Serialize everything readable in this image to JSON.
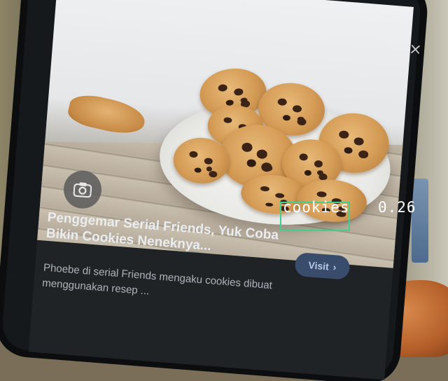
{
  "scene": {
    "background_icons": [
      "hand",
      "blue-object"
    ],
    "colors": {
      "detection_box": "#3fd18b",
      "caption_bg": "#1f2326",
      "visit_button_bg": "#3a4c6b"
    }
  },
  "phone_screen": {
    "close_symbol": "×",
    "menu_symbol": "⋮",
    "article": {
      "title": "Penggemar Serial Friends, Yuk Coba Bikin Cookies Neneknya...",
      "description": "Phoebe di serial Friends mengaku cookies dibuat menggunakan resep ...",
      "visit_label": "Visit",
      "visit_icon": "chevron-right-icon"
    },
    "lens_icon": "camera-lens-icon"
  },
  "detection": {
    "label": "cookies",
    "score": "0.26"
  }
}
